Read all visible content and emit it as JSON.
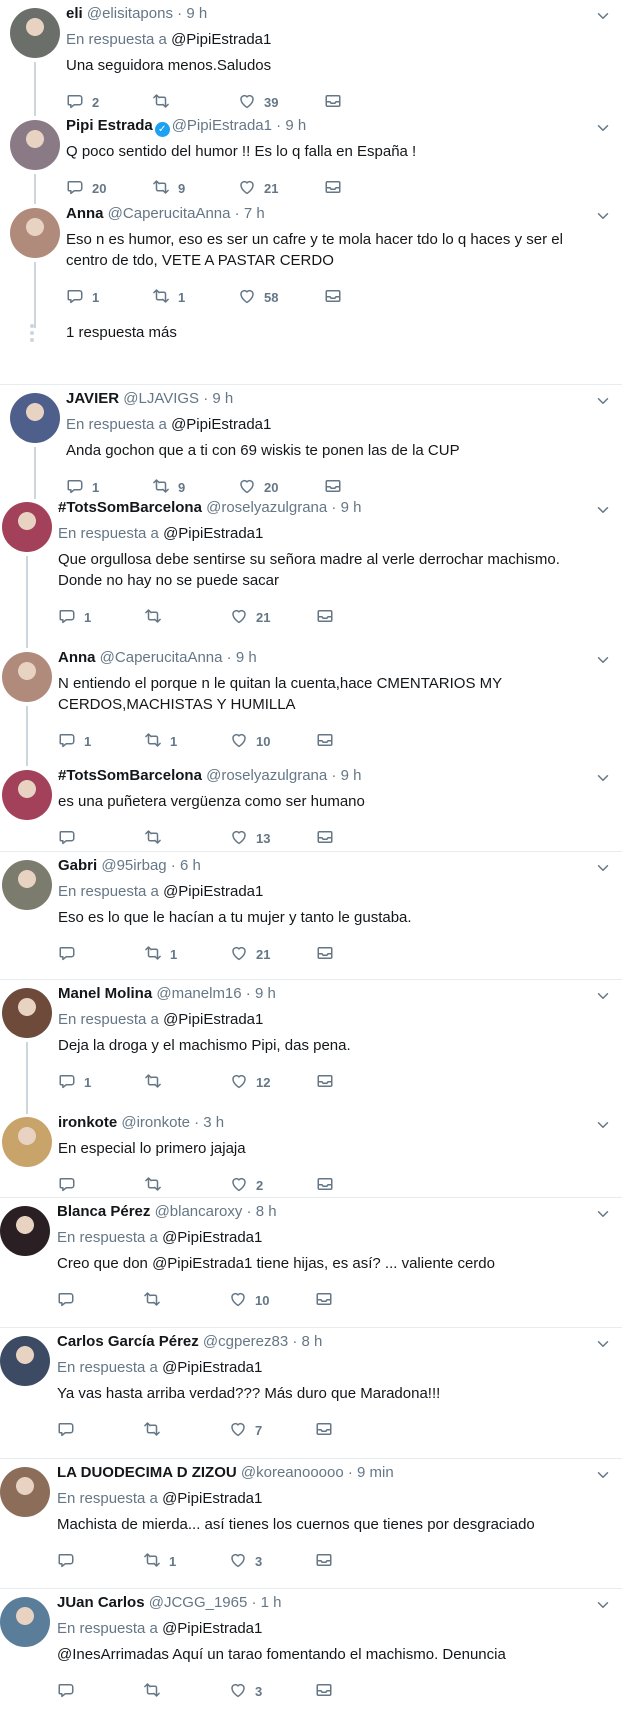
{
  "reply_prefix": "En respuesta a",
  "colors": {
    "accent": "#1da1f2",
    "secondary_text": "#657786",
    "thread_line": "#ccd6dd"
  },
  "more_replies": "1 respuesta más",
  "tweets": [
    {
      "name": "eli",
      "handle": "@elisitapons",
      "time": "9 h",
      "verified": false,
      "reply_to": "@PipiEstrada1",
      "text": [
        "Una seguidora menos.Saludos"
      ],
      "replies": "2",
      "retweets": "",
      "likes": "39",
      "avatar_color": "#6b6f6a"
    },
    {
      "name": "Pipi Estrada",
      "handle": "@PipiEstrada1",
      "time": "9 h",
      "verified": true,
      "reply_to": "",
      "text": [
        "Q poco sentido del humor !! Es lo q falla en España !"
      ],
      "replies": "20",
      "retweets": "9",
      "likes": "21",
      "avatar_color": "#8a7a86"
    },
    {
      "name": "Anna",
      "handle": "@CaperucitaAnna",
      "time": "7 h",
      "verified": false,
      "reply_to": "",
      "text": [
        "Eso n es humor, eso es ser un cafre y te mola hacer tdo lo q haces y ser el",
        "centro de tdo, VETE A PASTAR CERDO"
      ],
      "replies": "1",
      "retweets": "1",
      "likes": "58",
      "avatar_color": "#b08a7a"
    },
    {
      "name": "JAVIER",
      "handle": "@LJAVIGS",
      "time": "9 h",
      "verified": false,
      "reply_to": "@PipiEstrada1",
      "text": [
        "Anda gochon que a ti con 69 wiskis te ponen las de la CUP"
      ],
      "replies": "1",
      "retweets": "9",
      "likes": "20",
      "avatar_color": "#4d5f8a"
    },
    {
      "name": "#TotsSomBarcelona",
      "handle": "@roselyazulgrana",
      "time": "9 h",
      "verified": false,
      "reply_to": "@PipiEstrada1",
      "text": [
        "Que orgullosa debe sentirse su señora madre al verle derrochar machismo.",
        "Donde no hay no se puede sacar"
      ],
      "replies": "1",
      "retweets": "",
      "likes": "21",
      "avatar_color": "#a3415a"
    },
    {
      "name": "Anna",
      "handle": "@CaperucitaAnna",
      "time": "9 h",
      "verified": false,
      "reply_to": "",
      "text": [
        "N entiendo el porque n le quitan la cuenta,hace CMENTARIOS MY",
        "CERDOS,MACHISTAS Y HUMILLA"
      ],
      "replies": "1",
      "retweets": "1",
      "likes": "10",
      "avatar_color": "#b08a7a"
    },
    {
      "name": "#TotsSomBarcelona",
      "handle": "@roselyazulgrana",
      "time": "9 h",
      "verified": false,
      "reply_to": "",
      "text": [
        "es una puñetera vergüenza como ser humano"
      ],
      "replies": "",
      "retweets": "",
      "likes": "13",
      "avatar_color": "#a3415a"
    },
    {
      "name": "Gabri",
      "handle": "@95irbag",
      "time": "6 h",
      "verified": false,
      "reply_to": "@PipiEstrada1",
      "text": [
        "Eso es lo que le hacían a tu mujer y tanto le gustaba."
      ],
      "replies": "",
      "retweets": "1",
      "likes": "21",
      "avatar_color": "#7b7b6e"
    },
    {
      "name": "Manel Molina",
      "handle": "@manelm16",
      "time": "9 h",
      "verified": false,
      "reply_to": "@PipiEstrada1",
      "text": [
        "Deja la droga y el machismo Pipi, das pena."
      ],
      "replies": "1",
      "retweets": "",
      "likes": "12",
      "avatar_color": "#6e4a3a"
    },
    {
      "name": "ironkote",
      "handle": "@ironkote",
      "time": "3 h",
      "verified": false,
      "reply_to": "",
      "text": [
        "En especial lo primero jajaja"
      ],
      "replies": "",
      "retweets": "",
      "likes": "2",
      "avatar_color": "#c9a46a"
    },
    {
      "name": "Blanca Pérez",
      "handle": "@blancaroxy",
      "time": "8 h",
      "verified": false,
      "reply_to": "@PipiEstrada1",
      "text": [
        "Creo que don @PipiEstrada1 tiene hijas, es así? ... valiente cerdo"
      ],
      "replies": "",
      "retweets": "",
      "likes": "10",
      "avatar_color": "#2a1f22"
    },
    {
      "name": "Carlos García Pérez",
      "handle": "@cgperez83",
      "time": "8 h",
      "verified": false,
      "reply_to": "@PipiEstrada1",
      "text": [
        "Ya vas hasta arriba verdad??? Más duro que Maradona!!!"
      ],
      "replies": "",
      "retweets": "",
      "likes": "7",
      "avatar_color": "#3d4a63"
    },
    {
      "name": "LA DUODECIMA D ZIZOU",
      "handle": "@koreanooooo",
      "time": "9 min",
      "verified": false,
      "reply_to": "@PipiEstrada1",
      "text": [
        "Machista de mierda... así tienes los cuernos que tienes por desgraciado"
      ],
      "replies": "",
      "retweets": "1",
      "likes": "3",
      "avatar_color": "#8c6d5a"
    },
    {
      "name": "JUan Carlos",
      "handle": "@JCGG_1965",
      "time": "1 h",
      "verified": false,
      "reply_to": "@PipiEstrada1",
      "text": [
        "@InesArrimadas Aquí un tarao fomentando el machismo. Denuncia"
      ],
      "replies": "",
      "retweets": "",
      "likes": "3",
      "avatar_color": "#5a7d9a"
    }
  ]
}
